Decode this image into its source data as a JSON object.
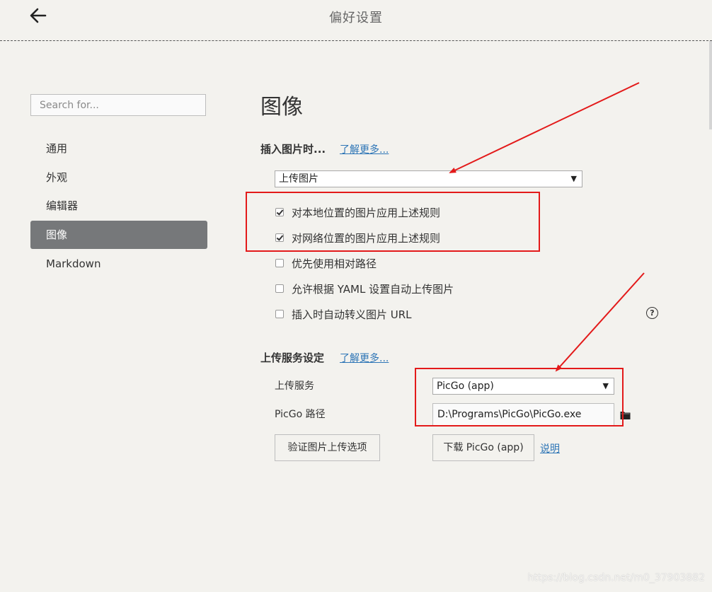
{
  "window": {
    "title": "偏好设置",
    "back_icon": "arrow-left-icon"
  },
  "sidebar": {
    "search_placeholder": "Search for...",
    "items": [
      {
        "label": "通用",
        "active": false
      },
      {
        "label": "外观",
        "active": false
      },
      {
        "label": "编辑器",
        "active": false
      },
      {
        "label": "图像",
        "active": true
      },
      {
        "label": "Markdown",
        "active": false
      }
    ]
  },
  "main": {
    "section_title": "图像",
    "insert_image": {
      "heading": "插入图片时...",
      "learn_more": "了解更多...",
      "selected_action": "上传图片",
      "options": [
        {
          "label": "对本地位置的图片应用上述规则",
          "checked": true
        },
        {
          "label": "对网络位置的图片应用上述规则",
          "checked": true
        },
        {
          "label": "优先使用相对路径",
          "checked": false
        },
        {
          "label": "允许根据 YAML 设置自动上传图片",
          "checked": false
        },
        {
          "label": "插入时自动转义图片 URL",
          "checked": false
        }
      ]
    },
    "upload_service": {
      "heading": "上传服务设定",
      "learn_more": "了解更多...",
      "service_label": "上传服务",
      "service_value": "PicGo (app)",
      "path_label": "PicGo 路径",
      "path_value": "D:\\Programs\\PicGo\\PicGo.exe",
      "validate_button": "验证图片上传选项",
      "download_button": "下载 PicGo (app)",
      "explain_link": "说明"
    }
  },
  "annotations": {
    "color": "#e31a1a"
  },
  "watermark": "https://blog.csdn.net/m0_37903882"
}
